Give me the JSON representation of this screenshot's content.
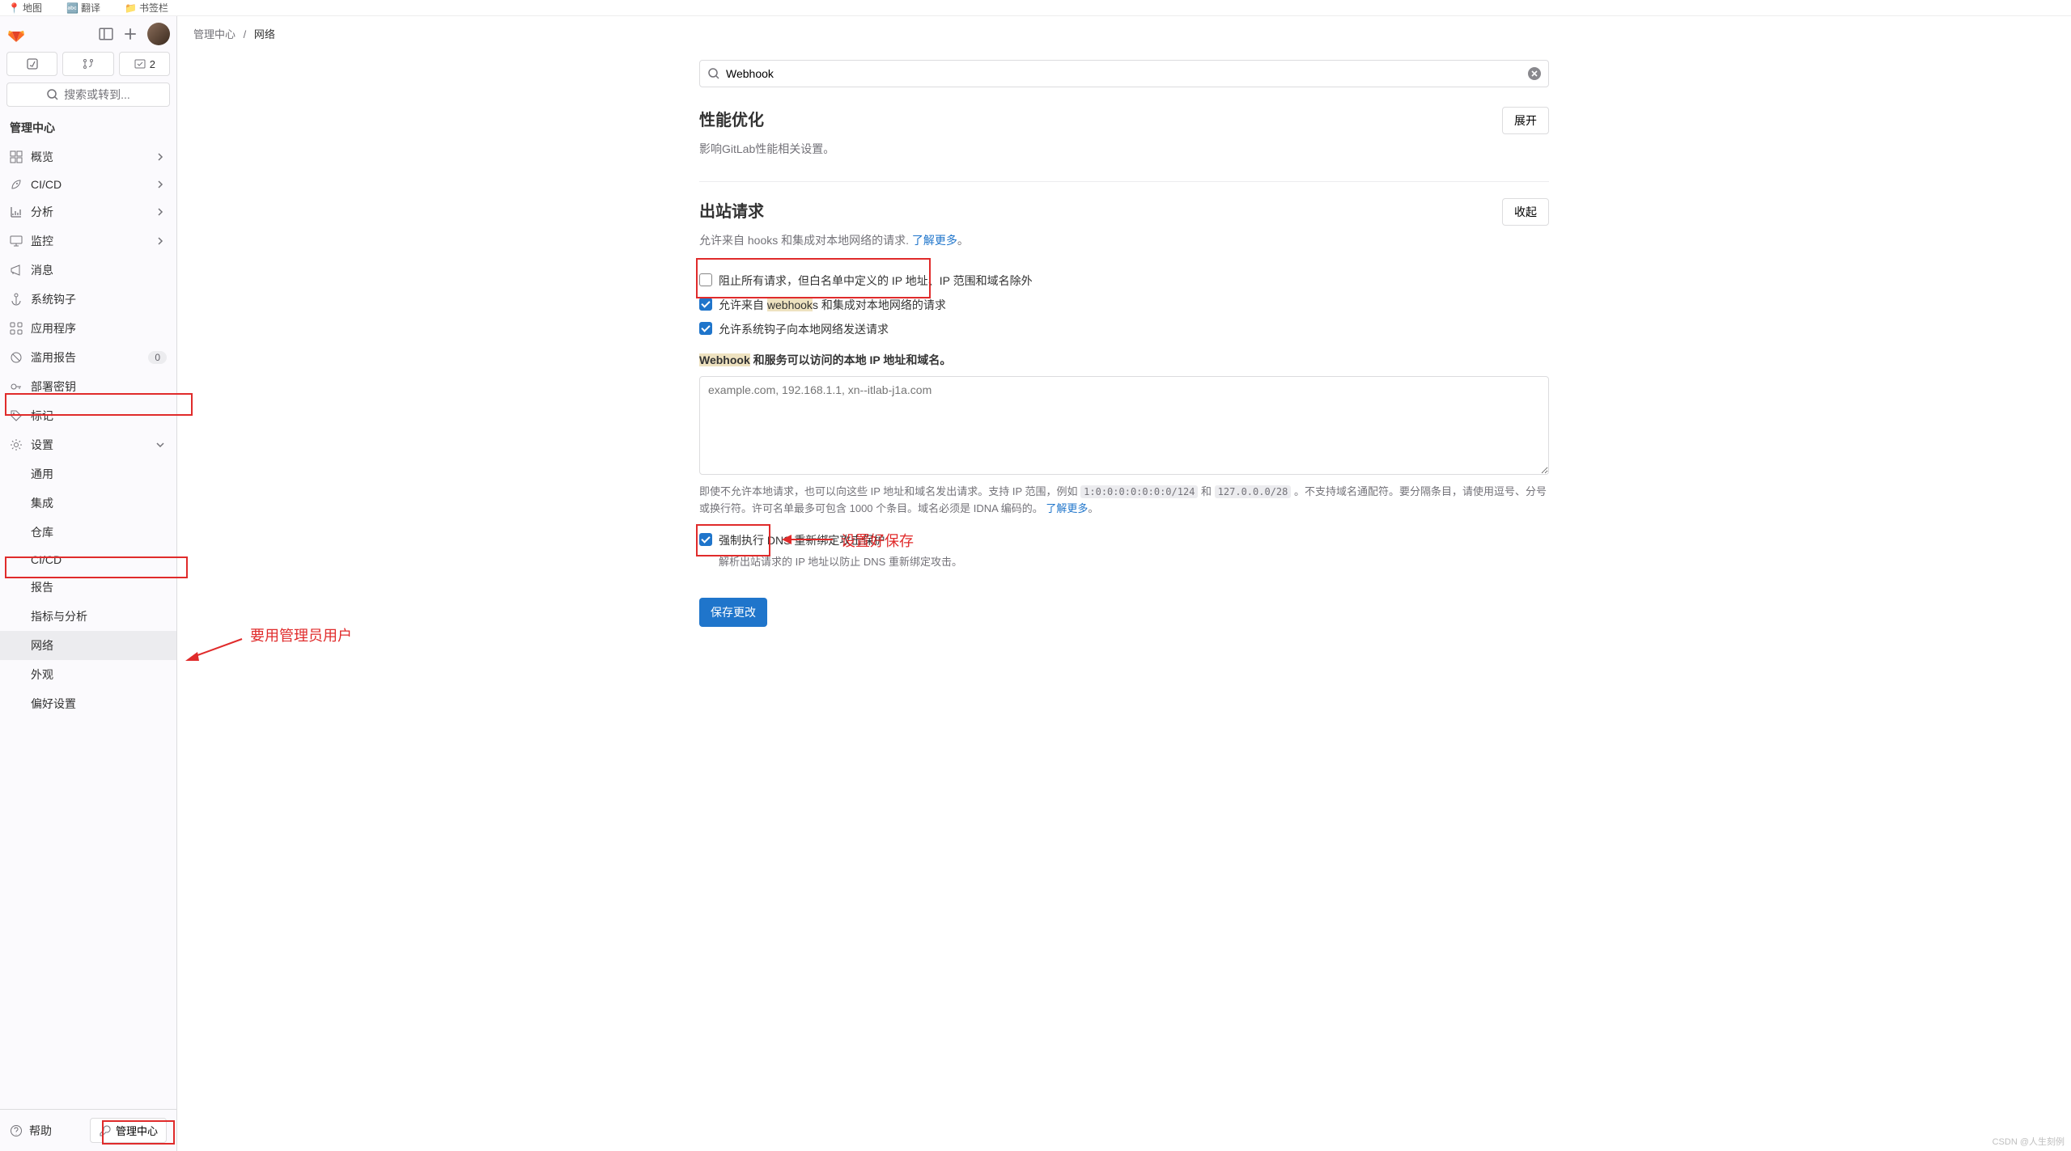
{
  "browser_bookmarks": {
    "map": "地图",
    "translate": "翻译",
    "bookmarks": "书签栏"
  },
  "search_placeholder": "搜索或转到...",
  "merge_count": "2",
  "section_title": "管理中心",
  "nav": {
    "overview": "概览",
    "cicd": "CI/CD",
    "analytics": "分析",
    "monitoring": "监控",
    "messages": "消息",
    "hooks": "系统钩子",
    "apps": "应用程序",
    "abuse": "滥用报告",
    "abuse_count": "0",
    "deploy_keys": "部署密钥",
    "labels": "标记",
    "settings": "设置"
  },
  "sub": {
    "general": "通用",
    "integrations": "集成",
    "repo": "仓库",
    "cicd": "CI/CD",
    "reports": "报告",
    "metrics": "指标与分析",
    "network": "网络",
    "appearance": "外观",
    "preferences": "偏好设置"
  },
  "help": "帮助",
  "admin_btn": "管理中心",
  "breadcrumb": {
    "admin": "管理中心",
    "cur": "网络"
  },
  "search_value": "Webhook",
  "sec1": {
    "title": "性能优化",
    "desc": "影响GitLab性能相关设置。",
    "btn": "展开"
  },
  "sec2": {
    "title": "出站请求",
    "desc_a": "允许来自 hooks 和集成对本地网络的请求. ",
    "desc_link": "了解更多",
    "desc_b": "。",
    "btn": "收起",
    "opt1": "阻止所有请求，但白名单中定义的 IP 地址、IP 范围和域名除外",
    "opt2_a": "允许来自 ",
    "opt2_hi": "webhook",
    "opt2_b": "s 和集成对本地网络的请求",
    "opt3": "允许系统钩子向本地网络发送请求",
    "field_label_a": "Webhook",
    "field_label_b": " 和服务可以访问的本地 IP 地址和域名。",
    "placeholder": "example.com, 192.168.1.1, xn--itlab-j1a.com",
    "help_a": "即使不允许本地请求，也可以向这些 IP 地址和域名发出请求。支持 IP 范围，例如 ",
    "help_code1": "1:0:0:0:0:0:0:0/124",
    "help_mid": " 和 ",
    "help_code2": "127.0.0.0/28",
    "help_b": " 。不支持域名通配符。要分隔条目，请使用逗号、分号或换行符。许可名单最多可包含 1000 个条目。域名必须是 IDNA 编码的。 ",
    "help_link": "了解更多",
    "help_c": "。",
    "dns_label": "强制执行 DNS 重新绑定攻击保护",
    "dns_desc": "解析出站请求的 IP 地址以防止 DNS 重新绑定攻击。",
    "save": "保存更改"
  },
  "anno": {
    "save": "设置好保存",
    "admin": "要用管理员用户"
  },
  "watermark": "CSDN @人生刻例"
}
